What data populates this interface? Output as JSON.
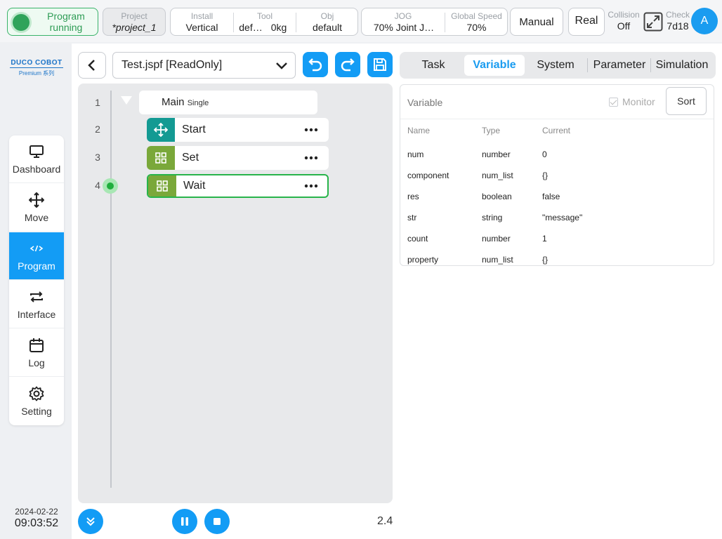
{
  "topbar": {
    "status": "Program running",
    "project_label": "Project",
    "project_value": "*project_1",
    "install_label": "Install",
    "install_value": "Vertical",
    "tool_label": "Tool",
    "tool_value": "def…",
    "tool_weight": "0kg",
    "obj_label": "Obj",
    "obj_value": "default",
    "jog_label": "JOG",
    "jog_value": "70%  Joint J…",
    "speed_label": "Global Speed",
    "speed_value": "70%",
    "manual": "Manual",
    "real": "Real",
    "collision_label": "Collision",
    "collision_value": "Off",
    "check_label": "Check",
    "check_value": "7d18",
    "avatar": "A"
  },
  "sidebar": {
    "logo_brand": "DUCO COBOT",
    "logo_sub": "Premium 系列",
    "items": [
      {
        "label": "Dashboard",
        "icon": "monitor-icon"
      },
      {
        "label": "Move",
        "icon": "move-icon"
      },
      {
        "label": "Program",
        "icon": "code-icon",
        "active": true
      },
      {
        "label": "Interface",
        "icon": "swap-icon"
      },
      {
        "label": "Log",
        "icon": "calendar-icon"
      },
      {
        "label": "Setting",
        "icon": "gear-icon"
      }
    ],
    "date": "2024-02-22",
    "time": "09:03:52"
  },
  "editor": {
    "file": "Test.jspf [ReadOnly]",
    "lines": [
      "1",
      "2",
      "3",
      "4"
    ],
    "main_label": "Main",
    "main_mode": "Single",
    "nodes": [
      {
        "label": "Start",
        "color": "#139a93"
      },
      {
        "label": "Set",
        "color": "#7aa83a"
      },
      {
        "label": "Wait",
        "color": "#7aa83a"
      }
    ],
    "version": "2.4"
  },
  "tabs": [
    "Task",
    "Variable",
    "System",
    "Parameter",
    "Simulation"
  ],
  "variables": {
    "title": "Variable",
    "monitor": "Monitor",
    "sort": "Sort",
    "columns": [
      "Name",
      "Type",
      "Current"
    ],
    "rows": [
      [
        "num",
        "number",
        "0"
      ],
      [
        "component",
        "num_list",
        "{}"
      ],
      [
        "res",
        "boolean",
        "false"
      ],
      [
        "str",
        "string",
        "\"message\""
      ],
      [
        "count",
        "number",
        "1"
      ],
      [
        "property",
        "num_list",
        "{}"
      ]
    ]
  }
}
